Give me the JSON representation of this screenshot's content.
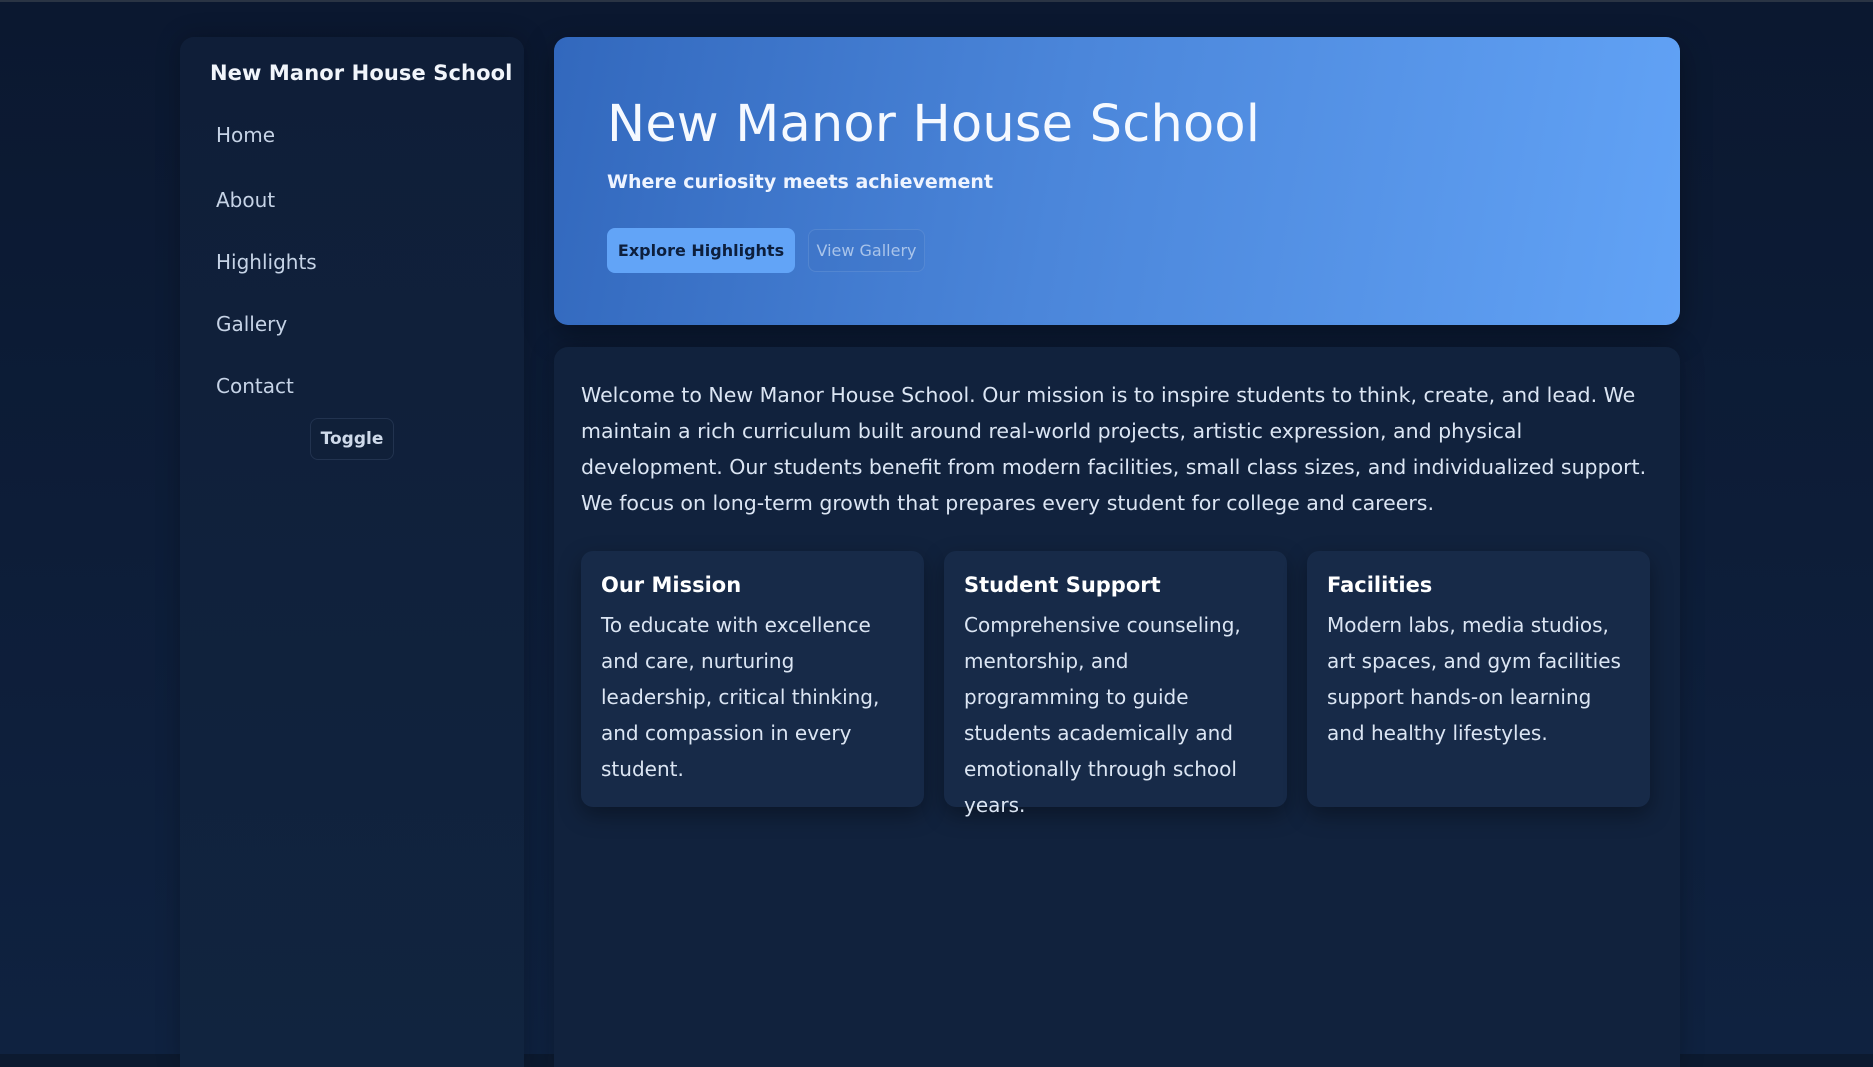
{
  "sidebar": {
    "brand": "New Manor House School",
    "items": [
      {
        "label": "Home"
      },
      {
        "label": "About"
      },
      {
        "label": "Highlights"
      },
      {
        "label": "Gallery"
      },
      {
        "label": "Contact"
      }
    ],
    "toggle_label": "Toggle"
  },
  "hero": {
    "title": "New Manor House School",
    "subtitle": "Where curiosity meets achievement",
    "primary_button": "Explore Highlights",
    "secondary_button": "View Gallery"
  },
  "main": {
    "intro": "Welcome to New Manor House School. Our mission is to inspire students to think, create, and lead. We maintain a rich curriculum built around real-world projects, artistic expression, and physical development. Our students benefit from modern facilities, small class sizes, and individualized support. We focus on long-term growth that prepares every student for college and careers.",
    "cards": [
      {
        "title": "Our Mission",
        "body": "To educate with excellence and care, nurturing leadership, critical thinking, and compassion in every student."
      },
      {
        "title": "Student Support",
        "body": "Comprehensive counseling, mentorship, and programming to guide students academically and emotionally through school years."
      },
      {
        "title": "Facilities",
        "body": "Modern labs, media studios, art spaces, and gym facilities support hands-on learning and healthy lifestyles."
      }
    ]
  },
  "colors": {
    "background": "#0c1a30",
    "sidebar": "#0f1e38",
    "hero_start": "#3268bd",
    "hero_end": "#62a3f6",
    "accent_button": "#62a4f7",
    "card": "#172a48"
  }
}
